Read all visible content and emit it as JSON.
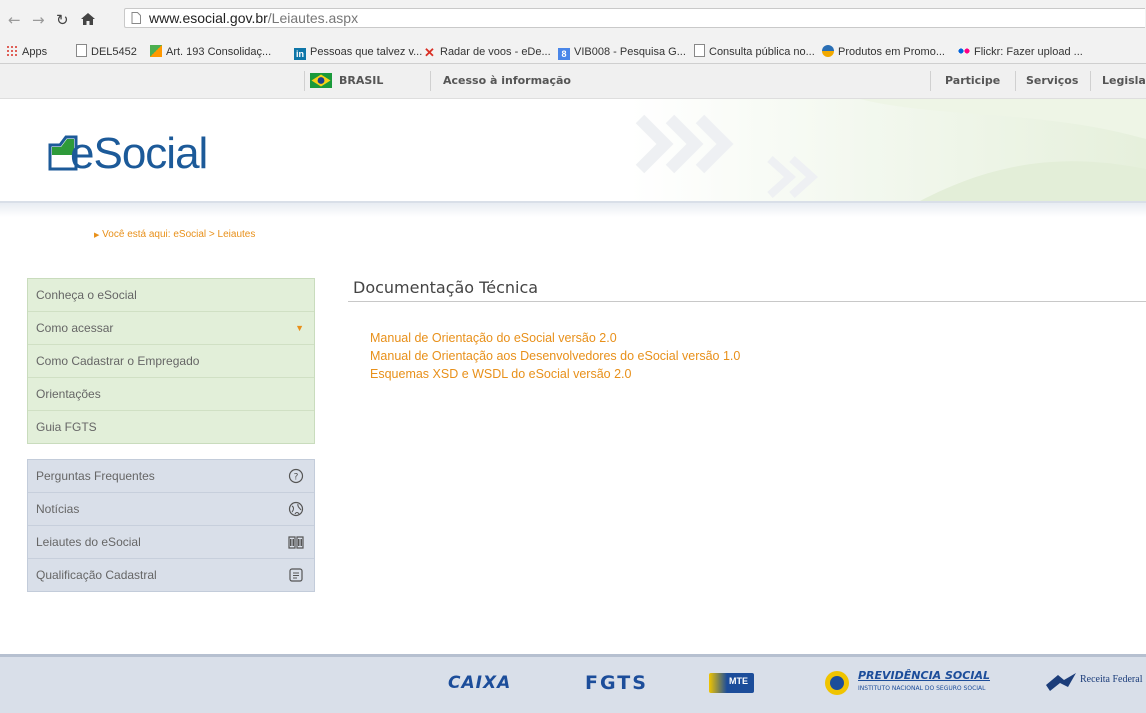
{
  "browser": {
    "url_host": "www.esocial.gov.br",
    "url_path": "/Leiautes.aspx",
    "bookmarks": [
      {
        "label": "Apps"
      },
      {
        "label": "DEL5452"
      },
      {
        "label": "Art. 193 Consolidaç..."
      },
      {
        "label": "Pessoas que talvez v..."
      },
      {
        "label": "Radar de voos - eDe..."
      },
      {
        "label": "VIB008 - Pesquisa G..."
      },
      {
        "label": "Consulta pública no..."
      },
      {
        "label": "Produtos em Promo..."
      },
      {
        "label": "Flickr: Fazer upload ..."
      }
    ]
  },
  "govbar": {
    "brasil": "BRASIL",
    "acesso": "Acesso à informação",
    "links": [
      "Participe",
      "Serviços",
      "Legislação"
    ]
  },
  "header": {
    "logo_text": "eSocial"
  },
  "breadcrumb": {
    "prefix": "Você está aqui:",
    "path": "eSocial > Leiautes"
  },
  "sidebar": {
    "menu1": [
      {
        "label": "Conheça o eSocial"
      },
      {
        "label": "Como acessar"
      },
      {
        "label": "Como Cadastrar o Empregado"
      },
      {
        "label": "Orientações"
      },
      {
        "label": "Guia FGTS"
      }
    ],
    "menu2": [
      {
        "label": "Perguntas Frequentes",
        "icon": "question-circle-icon"
      },
      {
        "label": "Notícias",
        "icon": "globe-icon"
      },
      {
        "label": "Leiautes do eSocial",
        "icon": "book-icon"
      },
      {
        "label": "Qualificação Cadastral",
        "icon": "document-icon"
      }
    ]
  },
  "main": {
    "title": "Documentação Técnica",
    "links": [
      "Manual de Orientação do eSocial versão 2.0",
      "Manual de Orientação aos Desenvolvedores do eSocial versão 1.0",
      "Esquemas XSD e WSDL do eSocial versão 2.0"
    ]
  },
  "footer": {
    "logos": [
      "CAIXA",
      "FGTS",
      "MTE",
      "PREVIDÊNCIA SOCIAL",
      "INSTITUTO NACIONAL DO SEGURO SOCIAL",
      "Receita Federal"
    ]
  },
  "colors": {
    "accent_orange": "#e8901a",
    "logo_blue": "#1c5a99",
    "logo_green": "#2e9a3a",
    "menu_green": "#e2efd9",
    "menu_blue": "#d9dfe9"
  }
}
